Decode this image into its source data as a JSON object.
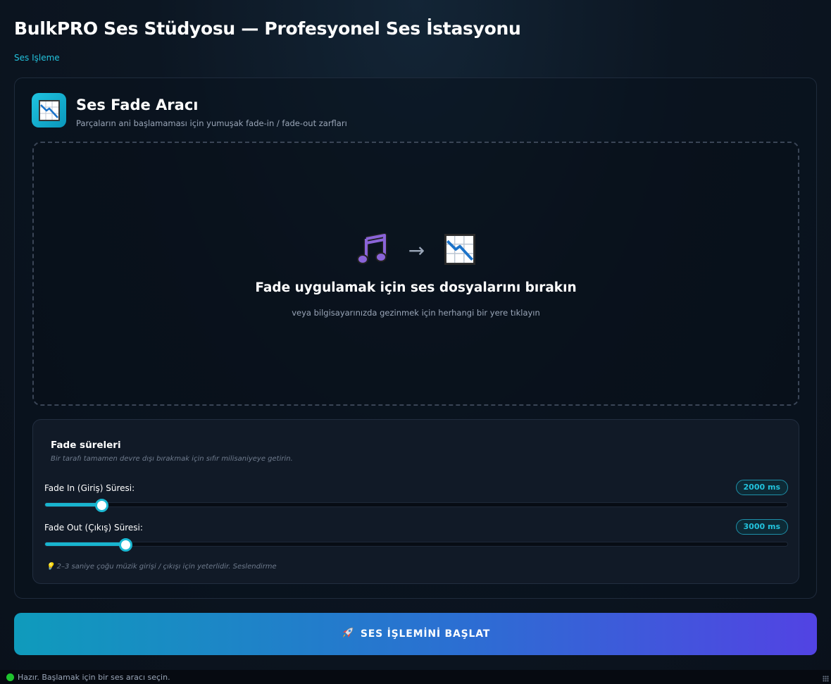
{
  "app": {
    "title": "BulkPRO Ses Stüdyosu — Profesyonel Ses İstasyonu",
    "breadcrumb": "Ses Işleme"
  },
  "tool": {
    "icon": "chart-decreasing-icon",
    "title": "Ses Fade Aracı",
    "subtitle": "Parçaların ani başlamaması için yumuşak fade-in / fade-out zarfları"
  },
  "dropzone": {
    "icon_from": "musical-notes-icon",
    "arrow": "→",
    "icon_to": "chart-decreasing-icon",
    "title": "Fade uygulamak için ses dosyalarını bırakın",
    "subtitle": "veya bilgisayarınızda gezinmek için herhangi bir yere tıklayın"
  },
  "settings": {
    "title": "Fade süreleri",
    "hint": "Bir tarafı tamamen devre dışı bırakmak için sıfır milisaniyeye getirin.",
    "sliders": [
      {
        "label": "Fade In (Giriş) Süresi:",
        "value": 2000,
        "display": "2000 ms",
        "fill_fraction": 0.076
      },
      {
        "label": "Fade Out (Çıkış) Süresi:",
        "value": 3000,
        "display": "3000 ms",
        "fill_fraction": 0.108
      }
    ],
    "tip": "💡 2–3 saniye çoğu müzik girişi / çıkışı için yeterlidir. Seslendirme"
  },
  "start_button": {
    "icon": "rocket-icon",
    "label": "SES İŞLEMİNİ BAŞLAT"
  },
  "status": {
    "text": "Hazır. Başlamak için bir ses aracı seçin.",
    "color": "#1ec32e"
  },
  "colors": {
    "accent": "#22c3dd",
    "button_gradient_start": "#0f9bbc",
    "button_gradient_end": "#5243e3"
  }
}
